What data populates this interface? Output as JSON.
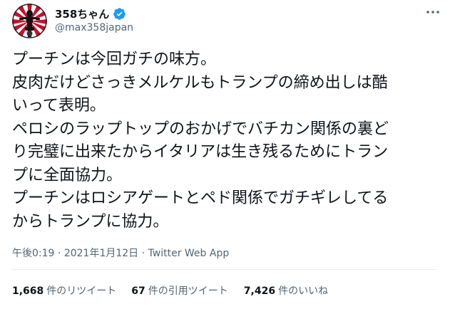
{
  "author": {
    "display_name": "358ちゃん",
    "handle": "@max358japan",
    "verified_color": "#1d9bf0"
  },
  "tweet": {
    "lines": [
      "プーチンは今回ガチの味方。",
      "皮肉だけどさっきメルケルもトランプの締め出しは酷",
      "いって表明。",
      "ペロシのラップトップのおかげでバチカン関係の裏ど",
      "り完璧に出来たからイタリアは生き残るためにトラン",
      "プに全面協力。",
      "プーチンはロシアゲートとペド関係でガチギレしてる",
      "からトランプに協力。"
    ]
  },
  "meta": {
    "time": "午後0:19",
    "separator": "·",
    "date": "2021年1月12日",
    "source": "Twitter Web App"
  },
  "stats": {
    "retweets_count": "1,668",
    "retweets_label": "件のリツイート",
    "quotes_count": "67",
    "quotes_label": "件の引用ツイート",
    "likes_count": "7,426",
    "likes_label": "件のいいね"
  },
  "icons": {
    "avatar": "motorcycle-rider-sunburst",
    "verified": "verified-badge-icon",
    "more": "more-dots-icon"
  },
  "colors": {
    "text_primary": "#0f1419",
    "text_secondary": "#536471",
    "divider": "#e6ecf0",
    "avatar_red": "#c8102e"
  }
}
